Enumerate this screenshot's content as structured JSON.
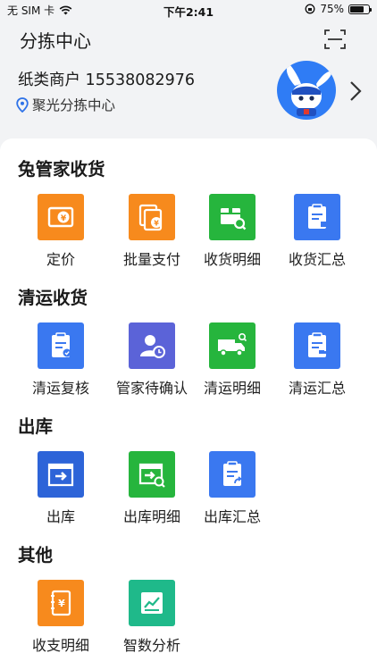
{
  "status_bar": {
    "carrier": "无 SIM 卡",
    "time": "下午2:41",
    "battery_percent": "75%",
    "battery_level": 0.75
  },
  "header": {
    "title": "分拣中心"
  },
  "profile": {
    "merchant": "纸类商户 15538082976",
    "location": "聚光分拣中心"
  },
  "sections": [
    {
      "title": "兔管家收货",
      "items": [
        {
          "label": "定价",
          "icon": "price-tag-icon",
          "color": "#f78a1d"
        },
        {
          "label": "批量支付",
          "icon": "batch-pay-icon",
          "color": "#f78a1d"
        },
        {
          "label": "收货明细",
          "icon": "receive-detail-icon",
          "color": "#26b53d"
        },
        {
          "label": "收货汇总",
          "icon": "receive-summary-icon",
          "color": "#3a78f0"
        }
      ]
    },
    {
      "title": "清运收货",
      "items": [
        {
          "label": "清运复核",
          "icon": "review-icon",
          "color": "#3a78f0"
        },
        {
          "label": "管家待确认",
          "icon": "user-pending-icon",
          "color": "#5b63d8"
        },
        {
          "label": "清运明细",
          "icon": "truck-icon",
          "color": "#26b53d"
        },
        {
          "label": "清运汇总",
          "icon": "transport-summary-icon",
          "color": "#3a78f0"
        }
      ]
    },
    {
      "title": "出库",
      "items": [
        {
          "label": "出库",
          "icon": "outbound-icon",
          "color": "#2d64d8"
        },
        {
          "label": "出库明细",
          "icon": "outbound-detail-icon",
          "color": "#26b53d"
        },
        {
          "label": "出库汇总",
          "icon": "outbound-summary-icon",
          "color": "#3a78f0"
        }
      ]
    },
    {
      "title": "其他",
      "items": [
        {
          "label": "收支明细",
          "icon": "ledger-icon",
          "color": "#f78a1d"
        },
        {
          "label": "智数分析",
          "icon": "analysis-icon",
          "color": "#1fb98a"
        }
      ]
    }
  ]
}
